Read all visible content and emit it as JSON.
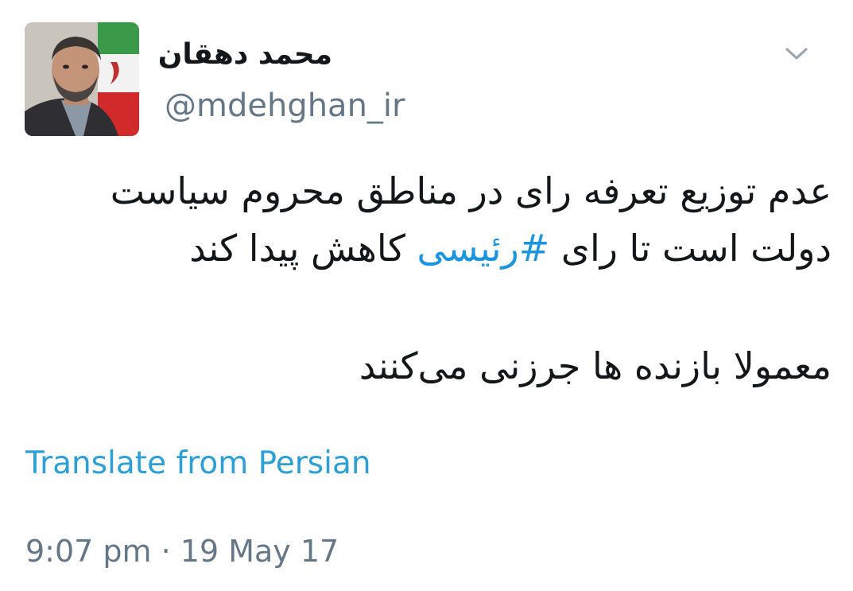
{
  "user": {
    "display_name": "محمد دهقان",
    "handle": "@mdehghan_ir"
  },
  "tweet": {
    "line1": "عدم توزیع تعرفه رای در مناطق محروم سیاست",
    "line2_before": "دولت است تا رای ",
    "hashtag": "#رئیسی",
    "line2_after": " کاهش پیدا کند",
    "line3": "معمولا بازنده ها جرزنی می‌کنند"
  },
  "translate_label": "Translate from Persian",
  "timestamp": "9:07 pm · 19 May 17",
  "icons": {
    "menu": "chevron-down-icon",
    "avatar": "avatar"
  },
  "colors": {
    "link": "#1b95e0",
    "muted": "#657786"
  }
}
